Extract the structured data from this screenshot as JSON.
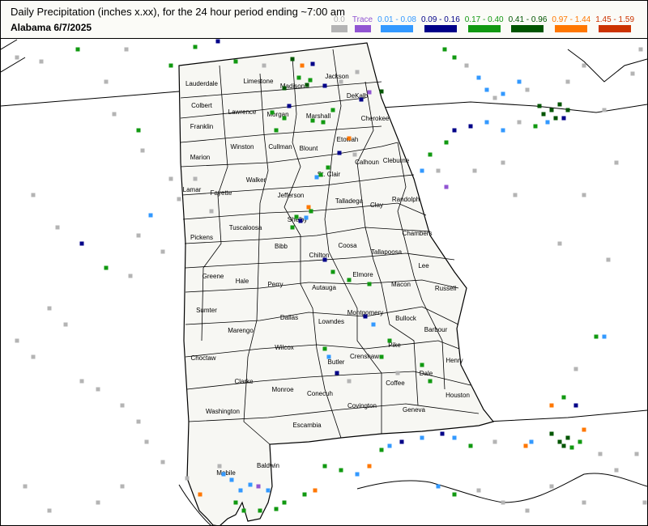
{
  "header": {
    "title": "Daily Precipitation (inches  x.xx),  for the 24 hour period ending ~7:00 am",
    "subtitle": "Alabama 6/7/2025"
  },
  "legend": [
    {
      "label": "0.0",
      "color": "#b4b4b4"
    },
    {
      "label": "Trace",
      "color": "#9155d2"
    },
    {
      "label": "0.01 - 0.08",
      "color": "#3399ff"
    },
    {
      "label": "0.09 - 0.16",
      "color": "#000088"
    },
    {
      "label": "0.17 - 0.40",
      "color": "#119911"
    },
    {
      "label": "0.41 - 0.96",
      "color": "#005500"
    },
    {
      "label": "0.97 - 1.44",
      "color": "#ff7700"
    },
    {
      "label": "1.45 - 1.59",
      "color": "#cc3300"
    }
  ],
  "counties": [
    "Lauderdale",
    "Limestone",
    "Madison",
    "Jackson",
    "Colbert",
    "Lawrence",
    "Morgan",
    "Marshall",
    "DeKalb",
    "Franklin",
    "Cherokee",
    "Marion",
    "Winston",
    "Cullman",
    "Blount",
    "Etowah",
    "Calhoun",
    "Cleburne",
    "Lamar",
    "Fayette",
    "Walker",
    "St. Clair",
    "Jefferson",
    "Talladega",
    "Clay",
    "Randolph",
    "Pickens",
    "Tuscaloosa",
    "Shelby",
    "Chambers",
    "Coosa",
    "Tallapoosa",
    "Bibb",
    "Chilton",
    "Lee",
    "Greene",
    "Hale",
    "Perry",
    "Elmore",
    "Macon",
    "Russell",
    "Autauga",
    "Sumter",
    "Dallas",
    "Montgomery",
    "Lowndes",
    "Bullock",
    "Marengo",
    "Barbour",
    "Wilcox",
    "Choctaw",
    "Pike",
    "Crenshaw",
    "Butler",
    "Henry",
    "Clarke",
    "Dale",
    "Coffee",
    "Monroe",
    "Houston",
    "Conecuh",
    "Washington",
    "Covington",
    "Geneva",
    "Escambia",
    "Baldwin",
    "Mobile"
  ]
}
